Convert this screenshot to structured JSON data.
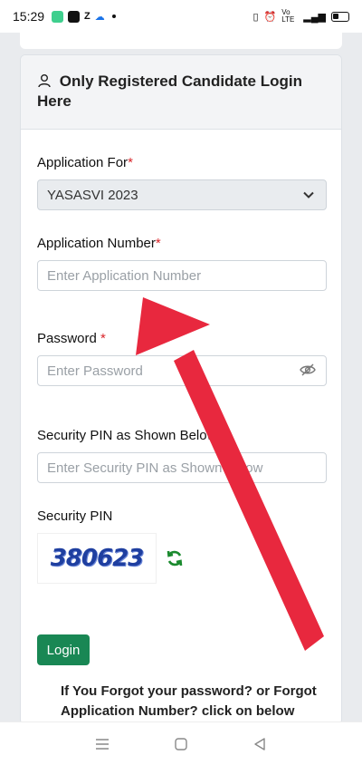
{
  "status_bar": {
    "time": "15:29",
    "app_icons": [
      "whatsapp-icon",
      "youtube-icon",
      "zomato-icon",
      "cloud-icon"
    ],
    "right_text": "Vo LTE"
  },
  "login_card": {
    "title": "Only Registered Candidate Login Here",
    "application_for": {
      "label": "Application For",
      "required_mark": "*",
      "selected": "YASASVI 2023"
    },
    "application_number": {
      "label": "Application Number",
      "required_mark": "*",
      "placeholder": "Enter Application Number"
    },
    "password": {
      "label": "Password ",
      "required_mark": "*",
      "placeholder": "Enter Password"
    },
    "security_pin_input": {
      "label": "Security PIN as Shown Below",
      "placeholder": "Enter Security PIN as Shown Below"
    },
    "security_pin": {
      "label": "Security PIN",
      "captcha": "380623"
    },
    "login_button": "Login",
    "forgot_text": "If You Forgot your password? or Forgot Application Number? click on below"
  },
  "colors": {
    "required": "#d9252a",
    "login_button": "#198754",
    "arrow": "#e8283e",
    "refresh_icon": "#1a8a2e"
  }
}
